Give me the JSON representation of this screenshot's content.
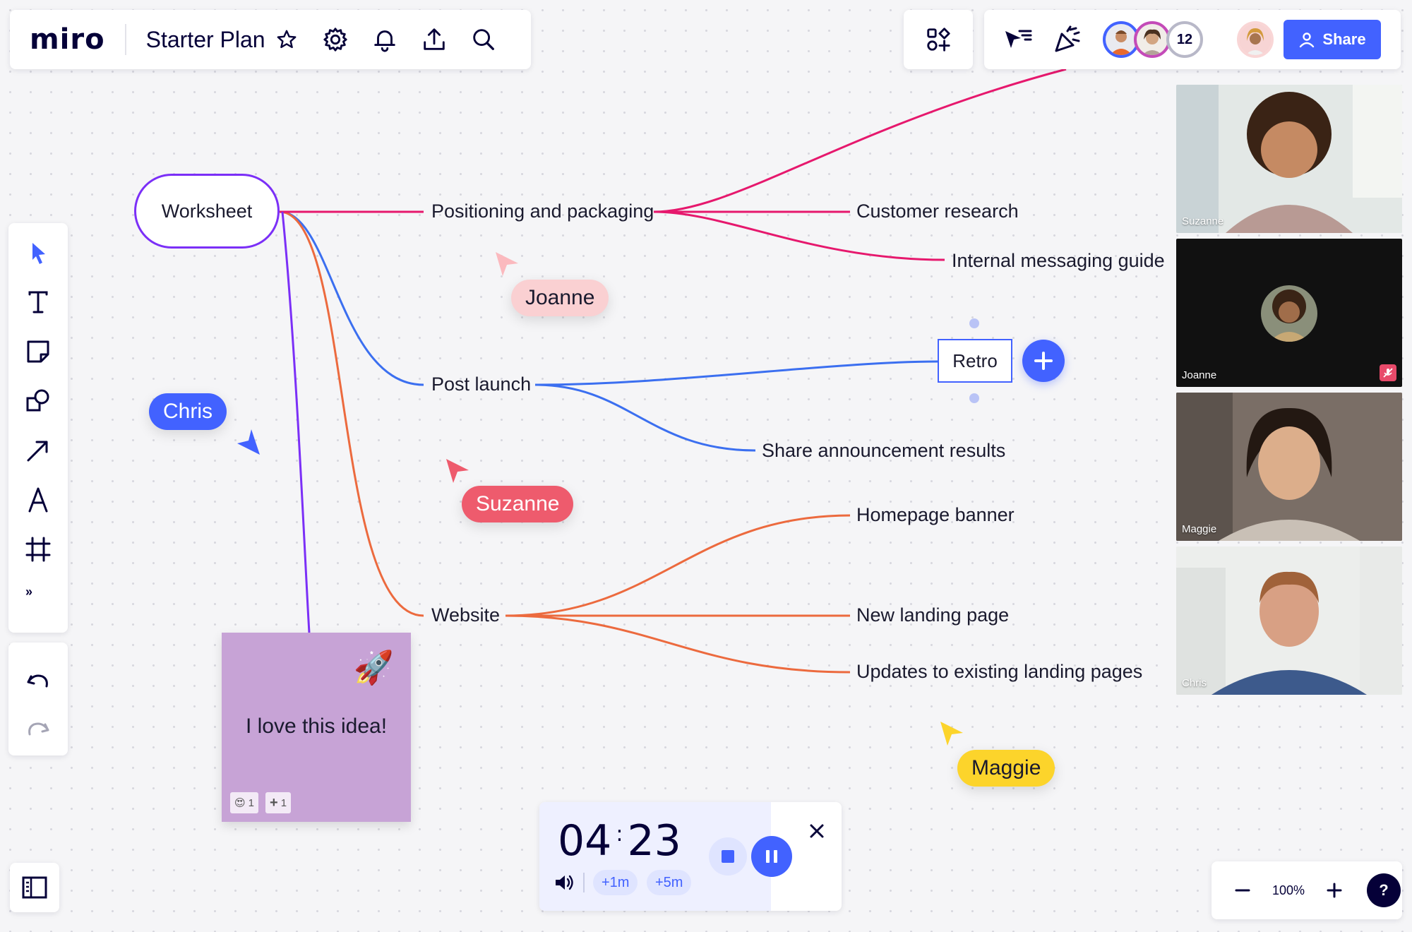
{
  "app": {
    "logo": "miro",
    "board_title": "Starter Plan"
  },
  "header": {
    "icons": [
      "star-icon",
      "gear-icon",
      "bell-icon",
      "upload-icon",
      "search-icon"
    ],
    "collab_icons": [
      "apps-icon",
      "reactions-cursor-icon",
      "celebrate-icon"
    ],
    "collaborator_count": "12",
    "share_label": "Share"
  },
  "toolbar": {
    "tools": [
      "select-tool",
      "text-tool",
      "sticky-note-tool",
      "shapes-tool",
      "connection-line-tool",
      "pen-tool",
      "frame-tool"
    ],
    "more": "»"
  },
  "mindmap": {
    "root": "Worksheet",
    "nodes": {
      "positioning": "Positioning and packaging",
      "customer_research": "Customer research",
      "internal_guide": "Internal messaging guide",
      "post_launch": "Post launch",
      "retro": "Retro",
      "share_results": "Share announcement results",
      "website": "Website",
      "homepage_banner": "Homepage banner",
      "new_landing": "New landing page",
      "updates_landing": "Updates to existing landing pages"
    },
    "colors": {
      "root": "#7b2ff7",
      "positioning": "#e6186d",
      "post_launch": "#3b6ff0",
      "website": "#ec6a3e"
    }
  },
  "cursors": {
    "joanne": {
      "name": "Joanne",
      "color": "#f9c6c9"
    },
    "chris": {
      "name": "Chris",
      "color": "#4262ff"
    },
    "suzanne": {
      "name": "Suzanne",
      "color": "#ee5b6d"
    },
    "maggie": {
      "name": "Maggie",
      "color": "#fcd42b"
    }
  },
  "sticky": {
    "text": "I love this idea!",
    "emoji": "🚀",
    "reactions": [
      {
        "icon": "😍",
        "count": "1"
      },
      {
        "icon": "+",
        "count": "1"
      }
    ]
  },
  "video": [
    {
      "name": "Suzanne",
      "muted": false
    },
    {
      "name": "Joanne",
      "muted": true
    },
    {
      "name": "Maggie",
      "muted": false
    },
    {
      "name": "Chris",
      "muted": false
    }
  ],
  "timer": {
    "minutes": "04",
    "seconds": "23",
    "add_one": "+1m",
    "add_five": "+5m"
  },
  "zoom": {
    "level": "100%",
    "help": "?"
  }
}
